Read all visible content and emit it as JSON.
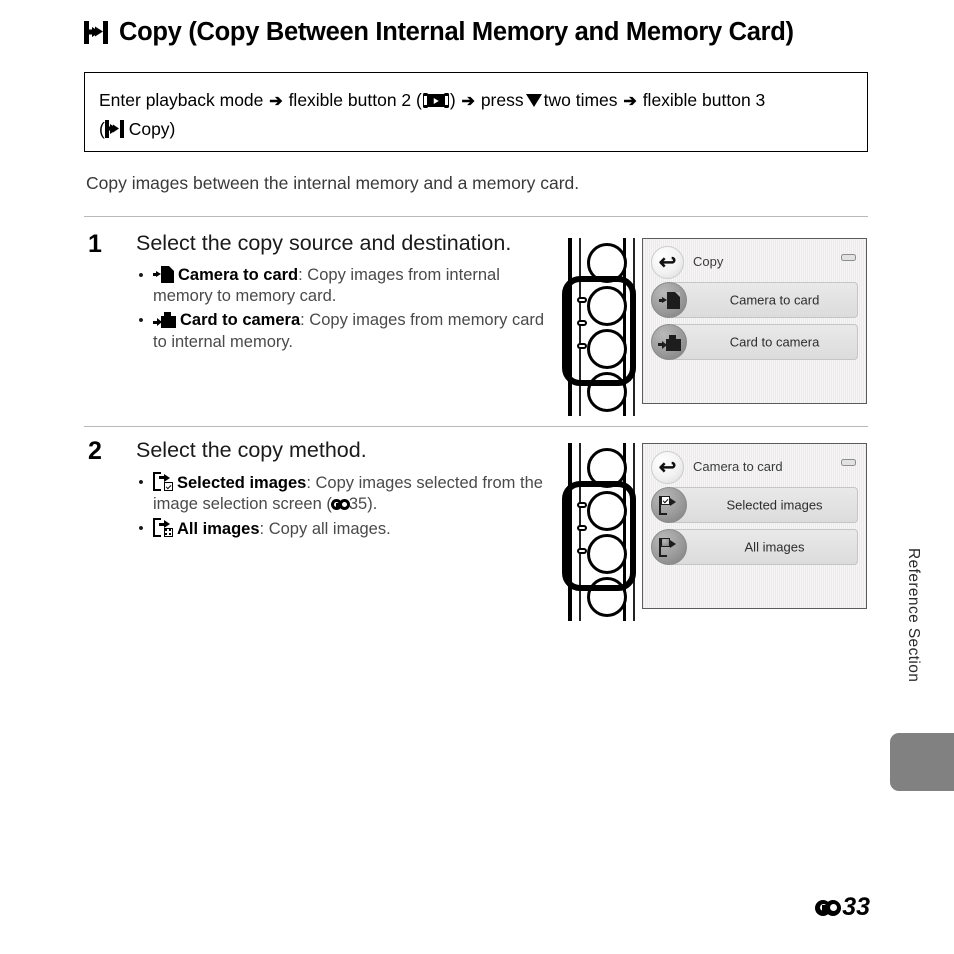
{
  "heading": {
    "icon": "copy-icon",
    "text": "Copy (Copy Between Internal Memory and Memory Card)"
  },
  "instruction_box": {
    "line1_a": "Enter playback mode",
    "arrow": "➔",
    "line1_b": "flexible button 2 (",
    "playback_icon": "playback-mode-icon",
    "line1_c": ")",
    "line1_d": "press",
    "down_icon": "down-arrow-icon",
    "line1_e": "two times",
    "line1_f": "flexible button 3",
    "line2_a": "(",
    "line2_icon": "copy-icon",
    "line2_b": "Copy)"
  },
  "intro": "Copy images between the internal memory and a memory card.",
  "steps": [
    {
      "number": "1",
      "title": "Select the copy source and destination.",
      "bullets": [
        {
          "icon": "camera-to-card-icon",
          "label": "Camera to card",
          "text": ": Copy images from internal memory to memory card."
        },
        {
          "icon": "card-to-camera-icon",
          "label": "Card to camera",
          "text": ": Copy images from memory card to internal memory."
        }
      ],
      "screen": {
        "header_title": "Copy",
        "back_icon": "back-arrow-icon",
        "battery_icon": "battery-icon",
        "rows": [
          {
            "icon": "camera-to-card-icon",
            "label": "Camera to card"
          },
          {
            "icon": "card-to-camera-icon",
            "label": "Card to camera"
          }
        ]
      }
    },
    {
      "number": "2",
      "title": "Select the copy method.",
      "bullets": [
        {
          "icon": "selected-images-icon",
          "label": "Selected images",
          "text": ": Copy images selected from the image selection screen (",
          "ref_icon": "reference-section-icon",
          "ref_page": "35",
          "text_end": ")."
        },
        {
          "icon": "all-images-icon",
          "label": "All images",
          "text": ": Copy all images."
        }
      ],
      "screen": {
        "header_title": "Camera to card",
        "back_icon": "back-arrow-icon",
        "battery_icon": "battery-icon",
        "rows": [
          {
            "icon": "selected-images-icon",
            "label": "Selected images"
          },
          {
            "icon": "all-images-icon",
            "label": "All images"
          }
        ]
      }
    }
  ],
  "side_label": "Reference Section",
  "footer": {
    "icon": "reference-section-icon",
    "page": "33"
  },
  "colors": {
    "rule": "#b9b9b9",
    "side_tab": "#818181",
    "screen_border": "#5b5b5b",
    "badge": "#9b9b9b"
  }
}
